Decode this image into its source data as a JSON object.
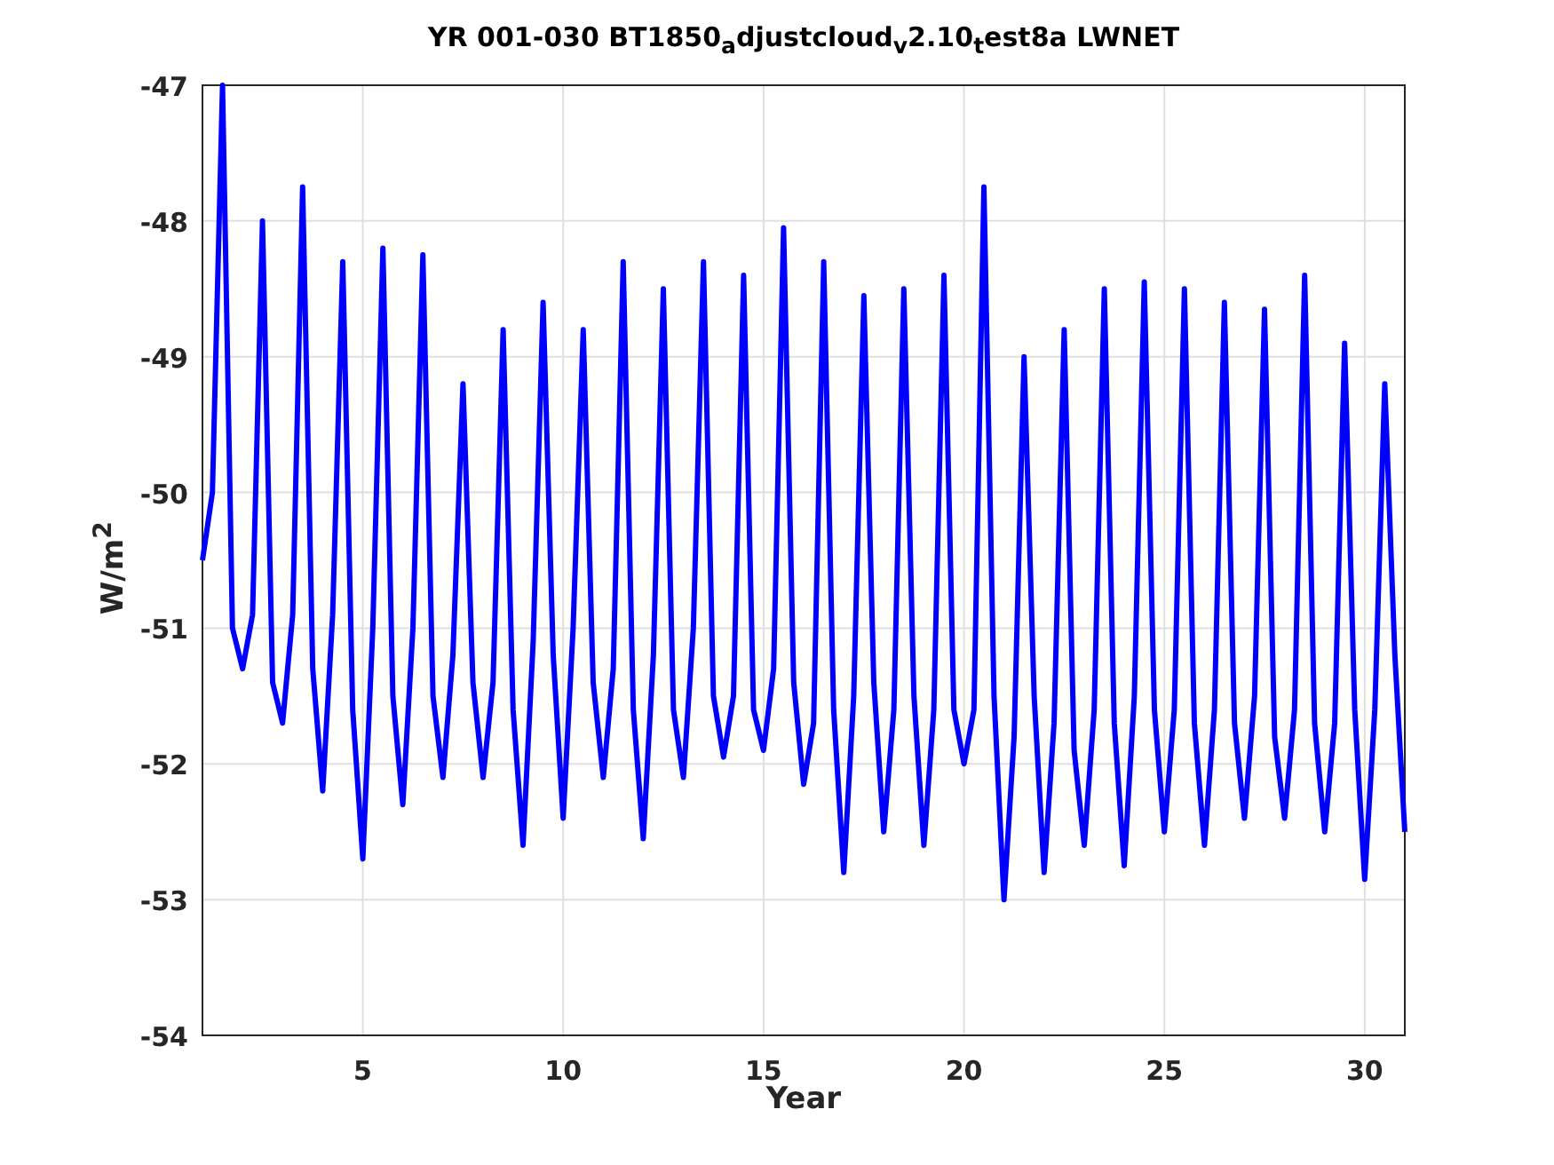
{
  "chart_data": {
    "type": "line",
    "title": "YR 001-030 BT1850$_{a}$djustcloud$_{v}$2.10$_{t}$est8a LWNET",
    "xlabel": "Year",
    "ylabel": "W/m$^{2}$",
    "grid": true,
    "xlim": [
      1,
      31
    ],
    "ylim": [
      -54,
      -47
    ],
    "xticks": [
      5,
      10,
      15,
      20,
      25,
      30
    ],
    "yticks": [
      -54,
      -53,
      -52,
      -51,
      -50,
      -49,
      -48,
      -47
    ],
    "x": [
      1,
      1.25,
      1.5,
      1.75,
      2,
      2.25,
      2.5,
      2.75,
      3,
      3.25,
      3.5,
      3.75,
      4,
      4.25,
      4.5,
      4.75,
      5,
      5.25,
      5.5,
      5.75,
      6,
      6.25,
      6.5,
      6.75,
      7,
      7.25,
      7.5,
      7.75,
      8,
      8.25,
      8.5,
      8.75,
      9,
      9.25,
      9.5,
      9.75,
      10,
      10.25,
      10.5,
      10.75,
      11,
      11.25,
      11.5,
      11.75,
      12,
      12.25,
      12.5,
      12.75,
      13,
      13.25,
      13.5,
      13.75,
      14,
      14.25,
      14.5,
      14.75,
      15,
      15.25,
      15.5,
      15.75,
      16,
      16.25,
      16.5,
      16.75,
      17,
      17.25,
      17.5,
      17.75,
      18,
      18.25,
      18.5,
      18.75,
      19,
      19.25,
      19.5,
      19.75,
      20,
      20.25,
      20.5,
      20.75,
      21,
      21.25,
      21.5,
      21.75,
      22,
      22.25,
      22.5,
      22.75,
      23,
      23.25,
      23.5,
      23.75,
      24,
      24.25,
      24.5,
      24.75,
      25,
      25.25,
      25.5,
      25.75,
      26,
      26.25,
      26.5,
      26.75,
      27,
      27.25,
      27.5,
      27.75,
      28,
      28.25,
      28.5,
      28.75,
      29,
      29.25,
      29.5,
      29.75,
      30,
      30.25,
      30.5,
      30.75,
      31
    ],
    "series": [
      {
        "color": "#0000ff",
        "values": [
          -50.5,
          -50.0,
          -47.0,
          -51.0,
          -51.3,
          -50.9,
          -48.0,
          -51.4,
          -51.7,
          -50.9,
          -47.75,
          -51.3,
          -52.2,
          -50.9,
          -48.3,
          -51.6,
          -52.7,
          -51.0,
          -48.2,
          -51.5,
          -52.3,
          -51.0,
          -48.25,
          -51.5,
          -52.1,
          -51.2,
          -49.2,
          -51.4,
          -52.1,
          -51.4,
          -48.8,
          -51.6,
          -52.6,
          -51.1,
          -48.6,
          -51.2,
          -52.4,
          -51.0,
          -48.8,
          -51.4,
          -52.1,
          -51.3,
          -48.3,
          -51.6,
          -52.55,
          -51.2,
          -48.5,
          -51.6,
          -52.1,
          -51.0,
          -48.3,
          -51.5,
          -51.95,
          -51.5,
          -48.4,
          -51.6,
          -51.9,
          -51.3,
          -48.05,
          -51.4,
          -52.15,
          -51.7,
          -48.3,
          -51.6,
          -52.8,
          -51.5,
          -48.55,
          -51.4,
          -52.5,
          -51.6,
          -48.5,
          -51.5,
          -52.6,
          -51.6,
          -48.4,
          -51.6,
          -52.0,
          -51.6,
          -47.75,
          -51.5,
          -53.0,
          -51.8,
          -49.0,
          -51.5,
          -52.8,
          -51.7,
          -48.8,
          -51.9,
          -52.6,
          -51.6,
          -48.5,
          -51.7,
          -52.75,
          -51.5,
          -48.45,
          -51.6,
          -52.5,
          -51.6,
          -48.5,
          -51.7,
          -52.6,
          -51.6,
          -48.6,
          -51.7,
          -52.4,
          -51.5,
          -48.65,
          -51.8,
          -52.4,
          -51.6,
          -48.4,
          -51.7,
          -52.5,
          -51.7,
          -48.9,
          -51.6,
          -52.85,
          -51.6,
          -49.2,
          -51.2,
          -52.5
        ]
      }
    ]
  }
}
